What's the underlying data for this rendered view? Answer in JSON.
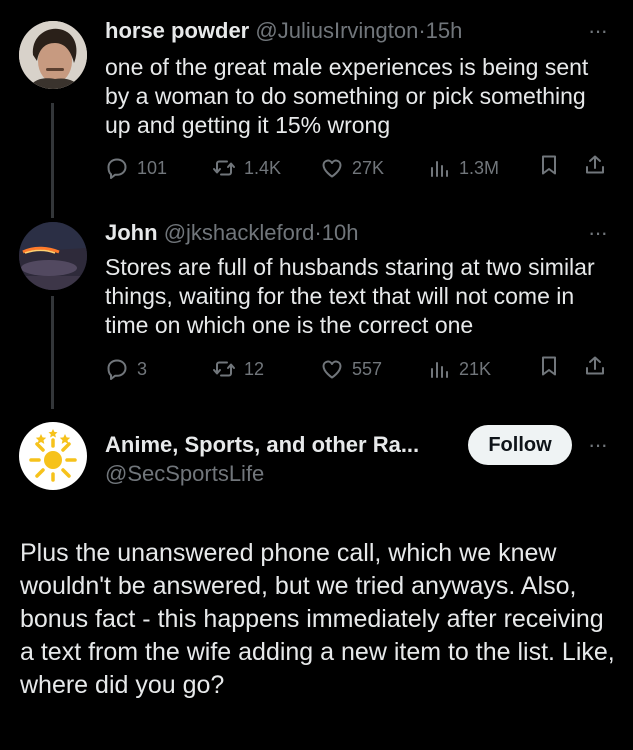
{
  "tweets": [
    {
      "name": "horse powder",
      "handle": "@JuliusIrvington",
      "time": "15h",
      "text": "one of the great male experiences is being sent by a woman to do something or pick something up and getting it 15% wrong",
      "replies": "101",
      "retweets": "1.4K",
      "likes": "27K",
      "views": "1.3M"
    },
    {
      "name": "John",
      "handle": "@jkshackleford",
      "time": "10h",
      "text": "Stores are full of husbands staring at two similar things, waiting for the text that will not come in time on which one is the correct one",
      "replies": "3",
      "retweets": "12",
      "likes": "557",
      "views": "21K"
    }
  ],
  "main": {
    "name": "Anime, Sports, and other Ra...",
    "handle": "@SecSportsLife",
    "follow_label": "Follow",
    "text": "Plus the unanswered phone call, which we knew wouldn't be answered, but we tried anyways. Also, bonus fact - this happens immediately after receiving a text from the wife adding a new item to the list.  Like, where did you go?"
  },
  "ui": {
    "separator": "·",
    "more": "···"
  },
  "icons": {
    "reply": "reply-icon",
    "retweet": "retweet-icon",
    "like": "heart-icon",
    "views": "views-icon",
    "bookmark": "bookmark-icon",
    "share": "share-icon",
    "more": "more-icon"
  },
  "colors": {
    "background": "#000000",
    "text": "#e7e9ea",
    "muted": "#71767b",
    "thread_line": "#333639",
    "follow_bg": "#eff3f4",
    "sun": "#f6c21b"
  }
}
